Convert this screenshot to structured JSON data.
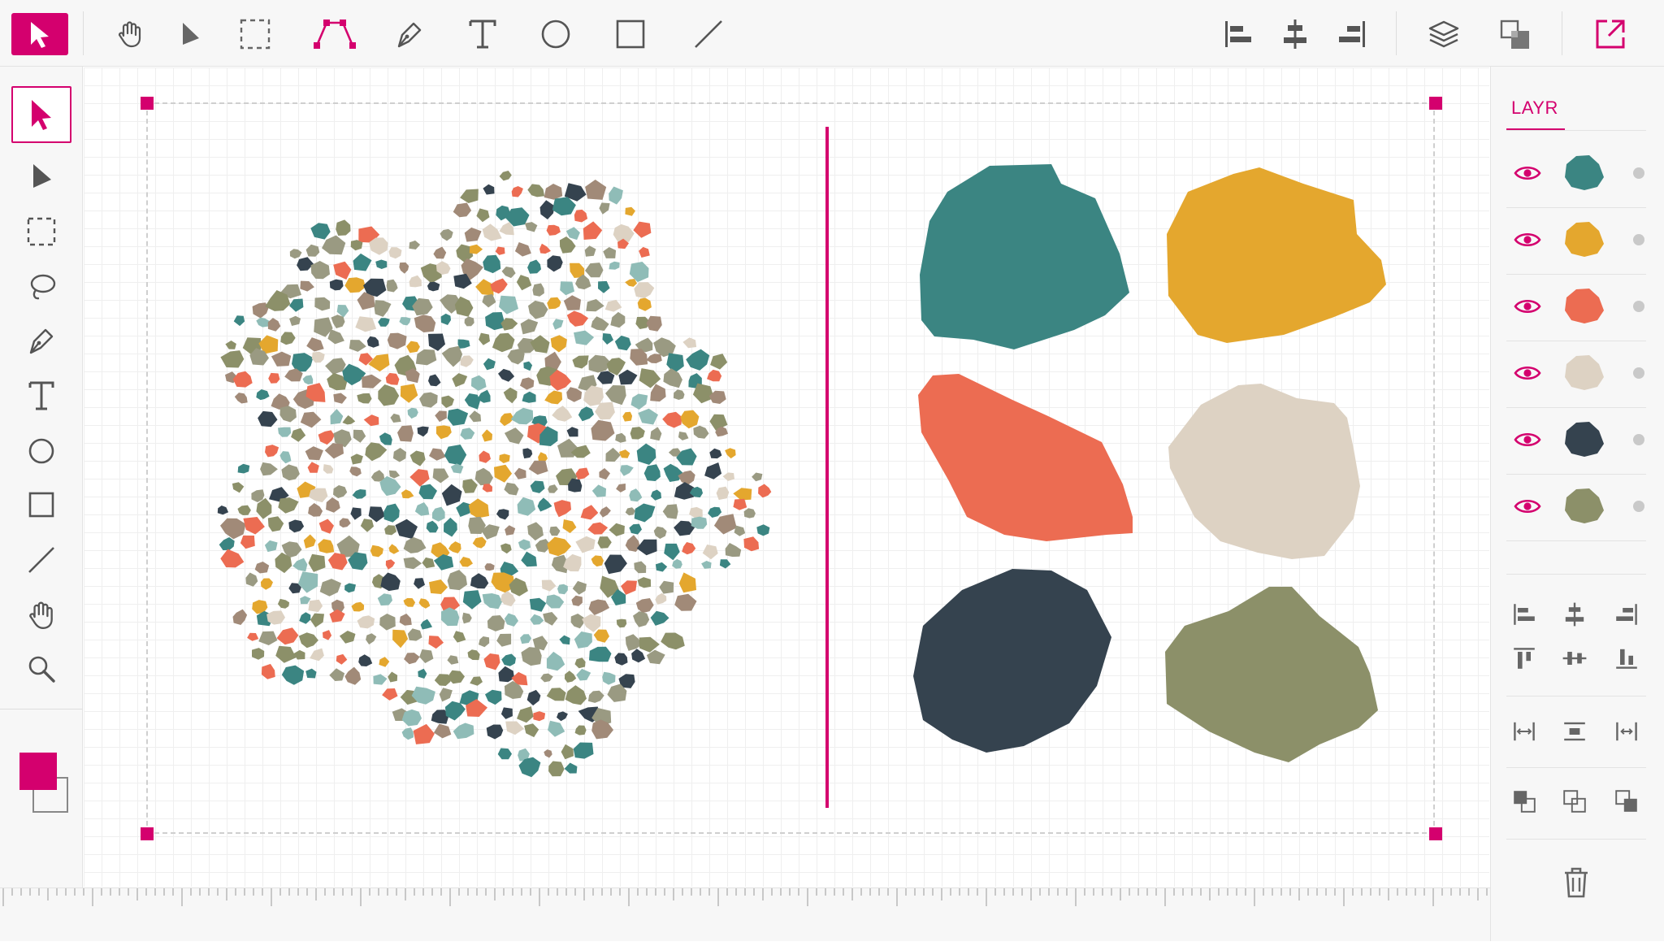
{
  "app": {
    "accent": "#d4006e",
    "chrome_bg": "#f7f7f7"
  },
  "toolbar": {
    "tools": [
      {
        "name": "hand-icon"
      },
      {
        "name": "direct-select-icon"
      },
      {
        "name": "marquee-icon"
      },
      {
        "name": "bezier-path-icon",
        "active": true
      },
      {
        "name": "pen-icon"
      },
      {
        "name": "text-icon"
      },
      {
        "name": "ellipse-icon"
      },
      {
        "name": "rectangle-icon"
      },
      {
        "name": "line-icon"
      }
    ],
    "right_tools": [
      {
        "name": "align-left-icon"
      },
      {
        "name": "align-center-icon"
      },
      {
        "name": "align-right-icon"
      },
      {
        "name": "layers-icon"
      },
      {
        "name": "arrange-icon"
      },
      {
        "name": "export-icon"
      }
    ]
  },
  "side_tools": [
    {
      "name": "select-icon",
      "active": true
    },
    {
      "name": "direct-select-icon"
    },
    {
      "name": "marquee-icon"
    },
    {
      "name": "lasso-icon"
    },
    {
      "name": "pen-icon"
    },
    {
      "name": "text-icon"
    },
    {
      "name": "ellipse-icon"
    },
    {
      "name": "rectangle-icon"
    },
    {
      "name": "line-icon"
    },
    {
      "name": "hand-icon"
    },
    {
      "name": "zoom-icon"
    }
  ],
  "swatches": {
    "fill": "#d4006e",
    "stroke": "#888888"
  },
  "layers_panel": {
    "tab_label": "LAYR",
    "layers": [
      {
        "color": "#3b8582",
        "visible": true
      },
      {
        "color": "#e4a72e",
        "visible": true
      },
      {
        "color": "#ec6c52",
        "visible": true
      },
      {
        "color": "#ddd2c3",
        "visible": true
      },
      {
        "color": "#35434f",
        "visible": true
      },
      {
        "color": "#8c9069",
        "visible": true
      }
    ]
  },
  "palette": [
    "#3b8582",
    "#e4a72e",
    "#ec6c52",
    "#ddd2c3",
    "#35434f",
    "#8c9069",
    "#9a9a82",
    "#8fbcb7",
    "#a18a78"
  ]
}
